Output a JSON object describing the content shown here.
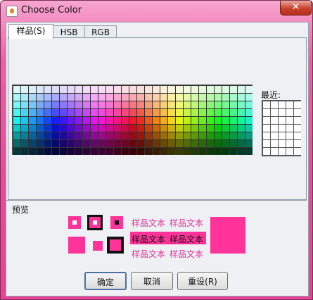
{
  "window": {
    "title": "Choose Color",
    "close_glyph": "✕"
  },
  "tabs": [
    {
      "label": "样品(S)"
    },
    {
      "label": "HSB"
    },
    {
      "label": "RGB"
    }
  ],
  "recent": {
    "label": "最近:"
  },
  "preview": {
    "label": "预览",
    "sample_text": "样品文本",
    "accent_color": "#ff3399"
  },
  "buttons": {
    "ok": "确定",
    "cancel": "取消",
    "reset": "重设(R)"
  }
}
